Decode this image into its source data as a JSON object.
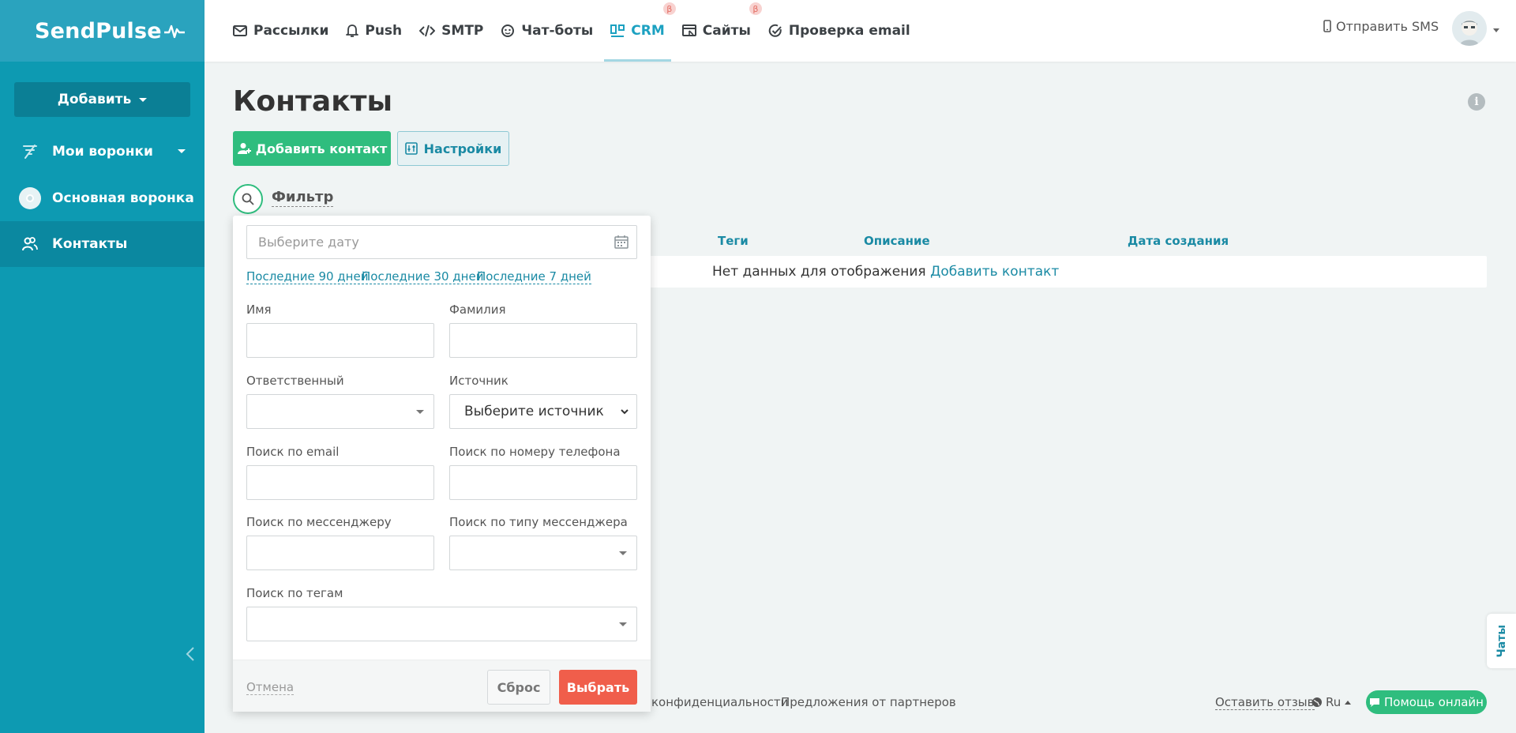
{
  "app": {
    "logo_text": "SendPulse",
    "colors": {
      "sidebar": "#0d9ab2",
      "accent": "#1ca1c1",
      "green": "#2fbd7e",
      "red": "#f05e4b"
    }
  },
  "sidebar": {
    "add_label": "Добавить",
    "items": [
      {
        "label": "Мои воронки",
        "icon": "funnel-icon"
      },
      {
        "label": "Основная воронка",
        "icon": "funnel-avatar-icon"
      },
      {
        "label": "Контакты",
        "icon": "contacts-icon"
      }
    ]
  },
  "nav": {
    "items": [
      {
        "label": "Рассылки",
        "icon": "mail-icon"
      },
      {
        "label": "Push",
        "icon": "bell-icon"
      },
      {
        "label": "SMTP",
        "icon": "code-icon"
      },
      {
        "label": "Чат-боты",
        "icon": "chat-bot-icon"
      },
      {
        "label": "CRM",
        "icon": "crm-icon",
        "badge": "β"
      },
      {
        "label": "Сайты",
        "icon": "sites-icon",
        "badge": "β"
      },
      {
        "label": "Проверка email",
        "icon": "check-circle-icon"
      }
    ],
    "sms_label": "Отправить SMS"
  },
  "main": {
    "title": "Контакты",
    "add_contact_label": "Добавить контакт",
    "settings_label": "Настройки",
    "filter_label": "Фильтр",
    "table": {
      "columns": [
        "Теги",
        "Описание",
        "Дата создания"
      ],
      "empty_text": "Нет данных для отображения",
      "empty_link": "Добавить контакт"
    }
  },
  "filter": {
    "date_placeholder": "Выберите дату",
    "quick_ranges": [
      "Последние 90 дней",
      "Последние 30 дней",
      "Последние 7 дней"
    ],
    "first_name_label": "Имя",
    "last_name_label": "Фамилия",
    "responsible_label": "Ответственный",
    "source_label": "Источник",
    "source_value": "Выберите источник",
    "email_label": "Поиск по email",
    "phone_label": "Поиск по номеру телефона",
    "messenger_label": "Поиск по мессенджеру",
    "messenger_type_label": "Поиск по типу мессенджера",
    "tags_label": "Поиск по тегам",
    "cancel_label": "Отмена",
    "reset_label": "Сброс",
    "apply_label": "Выбрать"
  },
  "footer": {
    "privacy_label": "конфиденциальности",
    "partners_label": "Предложения от партнеров",
    "review_label": "Оставить отзыв",
    "lang_label": "Ru",
    "help_label": "Помощь онлайн",
    "chats_label": "Чаты"
  }
}
